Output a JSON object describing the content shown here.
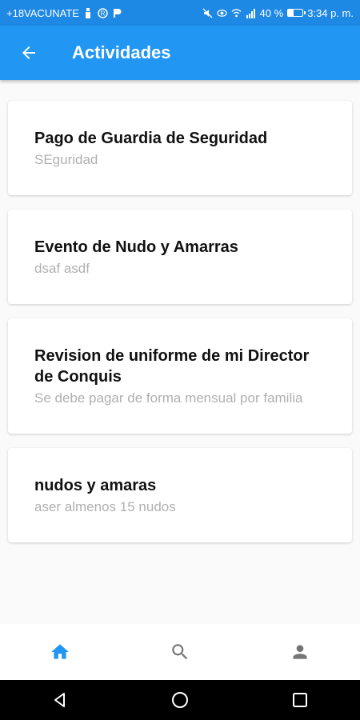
{
  "status_bar": {
    "carrier": "+18VACUNATE",
    "signal": "40 %",
    "time": "3:34 p. m."
  },
  "app_bar": {
    "title": "Actividades",
    "back_icon": "arrow-back-icon"
  },
  "activities": [
    {
      "title": "Pago de Guardia de Seguridad",
      "subtitle": "SEguridad"
    },
    {
      "title": "Evento de Nudo y Amarras",
      "subtitle": "dsaf asdf"
    },
    {
      "title": "Revision de uniforme de mi Director de Conquis",
      "subtitle": "Se debe pagar de forma mensual por familia"
    },
    {
      "title": "nudos y amaras",
      "subtitle": "aser almenos 15 nudos"
    }
  ],
  "bottom_nav": {
    "items": [
      {
        "name": "home-icon",
        "active": true
      },
      {
        "name": "search-icon",
        "active": false
      },
      {
        "name": "person-icon",
        "active": false
      }
    ]
  },
  "colors": {
    "primary": "#2196f3",
    "status_bar": "#1e88e5",
    "active_icon": "#2196f3",
    "inactive_icon": "#757575"
  }
}
